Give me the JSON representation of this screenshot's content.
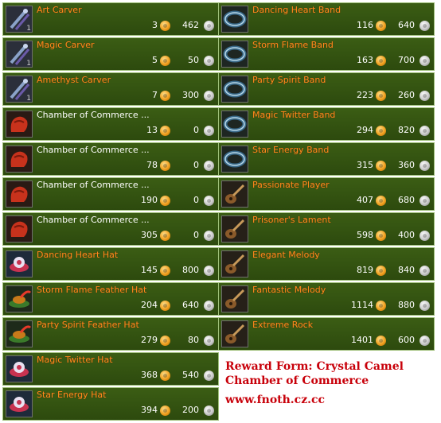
{
  "left_items": [
    {
      "name": "Art Carver",
      "color": "orange",
      "icon": "carver-icon",
      "qty": "1",
      "gold": "3",
      "silver": "462"
    },
    {
      "name": "Magic Carver",
      "color": "orange",
      "icon": "carver-icon",
      "qty": "1",
      "gold": "5",
      "silver": "50"
    },
    {
      "name": "Amethyst Carver",
      "color": "orange",
      "icon": "carver-icon",
      "qty": "1",
      "gold": "7",
      "silver": "300"
    },
    {
      "name": "Chamber of Commerce ...",
      "color": "white",
      "icon": "glove-icon",
      "qty": "",
      "gold": "13",
      "silver": "0"
    },
    {
      "name": "Chamber of Commerce ...",
      "color": "white",
      "icon": "glove-icon",
      "qty": "",
      "gold": "78",
      "silver": "0"
    },
    {
      "name": "Chamber of Commerce ...",
      "color": "white",
      "icon": "glove-icon",
      "qty": "",
      "gold": "190",
      "silver": "0"
    },
    {
      "name": "Chamber of Commerce ...",
      "color": "white",
      "icon": "glove-icon",
      "qty": "",
      "gold": "305",
      "silver": "0"
    },
    {
      "name": "Dancing Heart Hat",
      "color": "orange",
      "icon": "hat-icon",
      "qty": "",
      "gold": "145",
      "silver": "800"
    },
    {
      "name": "Storm Flame Feather Hat",
      "color": "orange",
      "icon": "feather-hat-icon",
      "qty": "",
      "gold": "204",
      "silver": "640"
    },
    {
      "name": "Party Spirit Feather Hat",
      "color": "orange",
      "icon": "feather-hat-icon",
      "qty": "",
      "gold": "279",
      "silver": "80"
    },
    {
      "name": "Magic Twitter Hat",
      "color": "orange",
      "icon": "hat-icon",
      "qty": "",
      "gold": "368",
      "silver": "540"
    },
    {
      "name": "Star Energy Hat",
      "color": "orange",
      "icon": "hat-icon",
      "qty": "",
      "gold": "394",
      "silver": "200"
    }
  ],
  "right_items": [
    {
      "name": "Dancing Heart Band",
      "color": "orange",
      "icon": "band-icon",
      "qty": "",
      "gold": "116",
      "silver": "640"
    },
    {
      "name": "Storm Flame Band",
      "color": "orange",
      "icon": "band-icon",
      "qty": "",
      "gold": "163",
      "silver": "700"
    },
    {
      "name": "Party Spirit Band",
      "color": "orange",
      "icon": "band-icon",
      "qty": "",
      "gold": "223",
      "silver": "260"
    },
    {
      "name": "Magic Twitter Band",
      "color": "orange",
      "icon": "band-icon",
      "qty": "",
      "gold": "294",
      "silver": "820"
    },
    {
      "name": "Star Energy Band",
      "color": "orange",
      "icon": "band-icon",
      "qty": "",
      "gold": "315",
      "silver": "360"
    },
    {
      "name": "Passionate Player",
      "color": "orange",
      "icon": "instrument-icon",
      "qty": "",
      "gold": "407",
      "silver": "680"
    },
    {
      "name": "Prisoner's Lament",
      "color": "orange",
      "icon": "instrument-icon",
      "qty": "",
      "gold": "598",
      "silver": "400"
    },
    {
      "name": "Elegant Melody",
      "color": "orange",
      "icon": "instrument-icon",
      "qty": "",
      "gold": "819",
      "silver": "840"
    },
    {
      "name": "Fantastic Melody",
      "color": "orange",
      "icon": "instrument-icon",
      "qty": "",
      "gold": "1114",
      "silver": "880"
    },
    {
      "name": "Extreme Rock",
      "color": "orange",
      "icon": "instrument-icon",
      "qty": "",
      "gold": "1401",
      "silver": "600"
    }
  ],
  "credits": {
    "line1": "Reward Form: Crystal Camel",
    "line2": "Chamber of Commerce",
    "line3": "www.fnoth.cz.cc"
  },
  "colors": {
    "name_orange": "#ff8a1e",
    "name_white": "#ffffff",
    "credits_red": "#c8000a",
    "panel_green": "#3b5d14"
  }
}
